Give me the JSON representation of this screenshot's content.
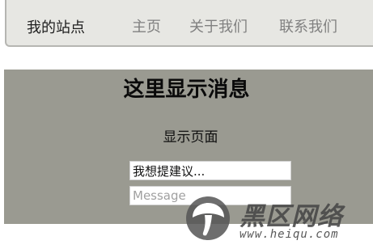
{
  "navbar": {
    "brand": "我的站点",
    "links": [
      {
        "label": "主页"
      },
      {
        "label": "关于我们"
      },
      {
        "label": "联系我们"
      }
    ]
  },
  "main": {
    "headline": "这里显示消息",
    "subtext": "显示页面",
    "suggestion_value": "我想提建议...",
    "message_placeholder": "Message"
  },
  "watermark": {
    "icon": "mushroom-logo-icon",
    "title": "黑区网络",
    "url": "www.heiqu.com"
  },
  "colors": {
    "navbar_bg": "#e7e7e3",
    "navbar_border": "#b6b6b2",
    "panel_bg": "#9a9a91",
    "nav_link": "#808080"
  }
}
